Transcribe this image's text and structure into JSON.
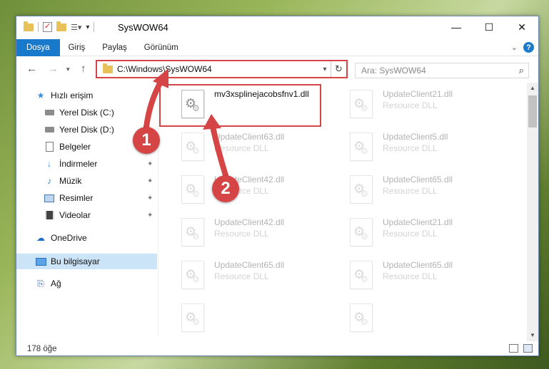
{
  "window": {
    "title": "SysWOW64"
  },
  "window_controls": [
    "—",
    "☐",
    "✕"
  ],
  "ribbon": {
    "tabs": [
      "Dosya",
      "Giriş",
      "Paylaş",
      "Görünüm"
    ],
    "help": "?"
  },
  "address_bar": {
    "path": "C:\\Windows\\SysWOW64",
    "refresh": "↻"
  },
  "search": {
    "placeholder": "Ara: SysWOW64"
  },
  "sidebar": {
    "items": [
      {
        "label": "Hızlı erişim",
        "icon": "star-icon"
      },
      {
        "label": "Yerel Disk (C:)",
        "icon": "drive-icon"
      },
      {
        "label": "Yerel Disk (D:)",
        "icon": "drive-icon"
      },
      {
        "label": "Belgeler",
        "icon": "document-icon"
      },
      {
        "label": "İndirmeler",
        "icon": "download-icon"
      },
      {
        "label": "Müzik",
        "icon": "music-icon"
      },
      {
        "label": "Resimler",
        "icon": "pictures-icon"
      },
      {
        "label": "Videolar",
        "icon": "video-icon"
      },
      {
        "label": "OneDrive",
        "icon": "cloud-icon"
      },
      {
        "label": "Bu bilgisayar",
        "icon": "computer-icon"
      },
      {
        "label": "Ağ",
        "icon": "network-icon"
      }
    ]
  },
  "files": [
    {
      "name": "mv3xsplinejacobsfnv1.dll",
      "type": ""
    },
    {
      "name": "UpdateClient21.dll",
      "type": "Resource DLL"
    },
    {
      "name": "UpdateClient63.dll",
      "type": "Resource DLL"
    },
    {
      "name": "UpdateClient5.dll",
      "type": "Resource DLL"
    },
    {
      "name": "UpdateClient42.dll",
      "type": "Resource DLL"
    },
    {
      "name": "UpdateClient65.dll",
      "type": "Resource DLL"
    },
    {
      "name": "UpdateClient42.dll",
      "type": "Resource DLL"
    },
    {
      "name": "UpdateClient21.dll",
      "type": "Resource DLL"
    },
    {
      "name": "UpdateClient65.dll",
      "type": "Resource DLL"
    },
    {
      "name": "UpdateClient65.dll",
      "type": "Resource DLL"
    },
    {
      "name": "",
      "type": ""
    },
    {
      "name": "",
      "type": ""
    }
  ],
  "status": {
    "item_count": "178 öğe"
  },
  "annotations": {
    "step1": "1",
    "step2": "2",
    "color": "#d64545"
  }
}
